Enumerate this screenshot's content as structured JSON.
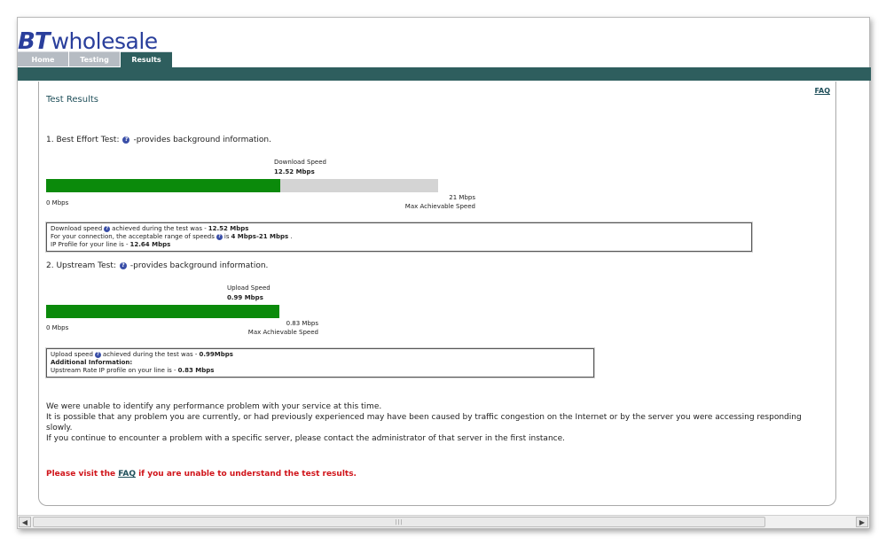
{
  "brand": {
    "bt": "BT",
    "wholesale": "wholesale"
  },
  "tabs": [
    {
      "label": "Home"
    },
    {
      "label": "Testing"
    },
    {
      "label": "Results"
    }
  ],
  "panel": {
    "title": "Test Results",
    "faq_link": "FAQ"
  },
  "best_effort": {
    "heading": "1. Best Effort Test:",
    "heading_suffix": "-provides background information.",
    "speed_title": "Download  Speed",
    "speed_value": "12.52 Mbps",
    "scale_min": "0 Mbps",
    "scale_max": "21 Mbps",
    "scale_max_label": "Max Achievable Speed",
    "fill_fraction": 0.5962,
    "info": {
      "line1_a": "Download speed",
      "line1_b": "achieved during the test was - ",
      "line1_value": "12.52 Mbps",
      "line2_a": "For your connection, the acceptable range of speeds",
      "line2_b": " is ",
      "line2_value": "4 Mbps-21 Mbps",
      "line2_end": ".",
      "line3_a": "IP Profile for your line is - ",
      "line3_value": "12.64 Mbps"
    }
  },
  "upstream": {
    "heading": "2. Upstream Test:",
    "heading_suffix": "-provides background information.",
    "speed_title": "Upload Speed",
    "speed_value": "0.99 Mbps",
    "scale_min": "0 Mbps",
    "scale_max": "0.83 Mbps",
    "scale_max_label": "Max Achievable Speed",
    "fill_fraction": 1.0,
    "info": {
      "line1_a": "Upload speed",
      "line1_b": " achieved during the test was - ",
      "line1_value": "0.99Mbps",
      "line2": "Additional Information:",
      "line3_a": "Upstream Rate IP profile on your line is - ",
      "line3_value": "0.83 Mbps"
    }
  },
  "message": {
    "line1": "We were unable to identify any performance problem with your service at this time.",
    "line2": "It is possible that any problem you are currently, or had previously experienced may have been caused by traffic congestion on the Internet or by the server you were accessing responding slowly.",
    "line3": "If you continue to encounter a problem with a specific server, please contact the administrator of that server in the first instance."
  },
  "note": {
    "prefix": "Please visit the ",
    "link": "FAQ",
    "suffix": " if you are unable to understand the test results."
  },
  "colors": {
    "brand_blue": "#2a3f9c",
    "teal": "#2e5e5e",
    "bar_green": "#0b8a0b",
    "bar_track": "#d4d4d4",
    "note_red": "#d0141a"
  },
  "icons": {
    "help": "question-icon",
    "scroll_left": "chevron-left-icon",
    "scroll_right": "chevron-right-icon"
  }
}
